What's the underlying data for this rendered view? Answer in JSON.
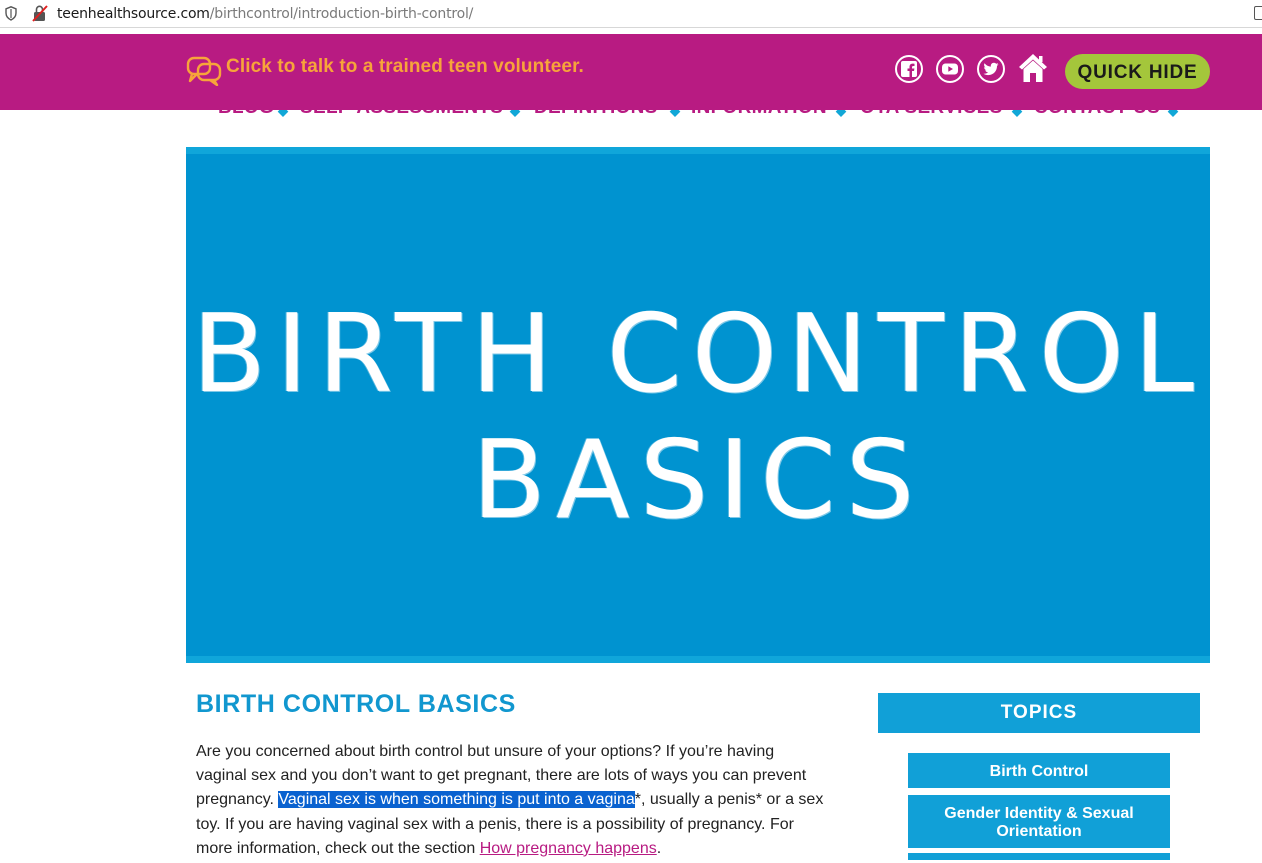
{
  "browser": {
    "url_domain": "teenhealthsource.com",
    "url_path": "/birthcontrol/introduction-birth-control/"
  },
  "header": {
    "chat_label": "Click to talk to a trained teen volunteer.",
    "quick_hide_label": "QUICK HIDE",
    "social": [
      "facebook-icon",
      "youtube-icon",
      "twitter-icon",
      "home-icon"
    ]
  },
  "nav": {
    "items": [
      "BLOG",
      "SELF-ASSESSMENTS",
      "DEFINITIONS",
      "INFORMATION",
      "OTA SERVICES",
      "CONTACT US"
    ]
  },
  "hero": {
    "line1": "BIRTH CONTROL",
    "line2": "BASICS"
  },
  "article": {
    "heading": "BIRTH CONTROL BASICS",
    "p1_before": "Are you concerned about birth control but unsure of your options? If you’re having vaginal sex and you don’t want to get pregnant, there are lots of ways you can prevent pregnancy. ",
    "p1_highlight": "Vaginal sex is when something is put into a vagina",
    "p1_after": "*, usually a penis* or a sex toy. If you are having vaginal sex with a penis, there is a possibility of pregnancy.  For more information, check out the section ",
    "p1_link": "How pregnancy happens",
    "p1_end": "."
  },
  "sidebar": {
    "title": "TOPICS",
    "topics": [
      "Birth Control",
      "Gender Identity & Sexual Orientation"
    ]
  },
  "colors": {
    "magenta": "#b81b82",
    "orange": "#f7a43a",
    "green": "#a4c63b",
    "blue": "#0093d0",
    "light_blue": "#11a0d7"
  }
}
